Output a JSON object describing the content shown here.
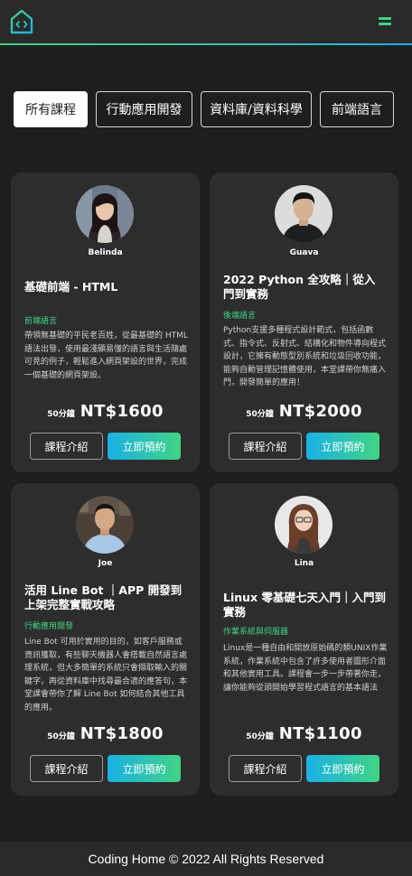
{
  "header": {
    "logo_icon": "code-house-logo",
    "menu_icon": "hamburger-menu-icon",
    "accent_colors": [
      "#41d483",
      "#1ab0e6"
    ]
  },
  "tabs": [
    {
      "label": "所有課程",
      "active": true
    },
    {
      "label": "行動應用開發",
      "active": false
    },
    {
      "label": "資料庫/資料科學",
      "active": false
    },
    {
      "label": "前端語言",
      "active": false
    }
  ],
  "courses": [
    {
      "teacher": "Belinda",
      "title": "基礎前端 - HTML",
      "category": "前端語言",
      "description": "帶領無基礎的平民老百姓，從最基礎的 HTML 語法出發，使用最淺顯易懂的語言與生活隨處可見的例子，輕鬆進入網頁架設的世界，完成一個基礎的網頁架設。",
      "duration": "50分鐘",
      "price": "NT$1600",
      "intro_label": "課程介紹",
      "book_label": "立即預約"
    },
    {
      "teacher": "Guava",
      "title": "2022 Python 全攻略｜從入門到實務",
      "category": "後端語言",
      "description": "Python支援多種程式設計範式，包括函數式、指令式、反射式、結構化和物件導向程式設計，它擁有動態型別系統和垃圾回收功能，能夠自動管理記憶體使用，本堂課帶你無痛入門，開發簡單的應用！",
      "duration": "50分鐘",
      "price": "NT$2000",
      "intro_label": "課程介紹",
      "book_label": "立即預約"
    },
    {
      "teacher": "Joe",
      "title": "活用 Line Bot ｜APP 開發到上架完整實戰攻略",
      "category": "行動應用開發",
      "description": "Line Bot 可用於實用的目的，如客戶服務或資訊獲取，有些聊天機器人會搭載自然語言處理系統，但大多簡單的系統只會擷取輸入的關鍵字，再從資料庫中找尋最合適的應答句，本堂課會帶你了解 Line Bot 如何結合其他工具的應用。",
      "duration": "50分鐘",
      "price": "NT$1800",
      "intro_label": "課程介紹",
      "book_label": "立即預約"
    },
    {
      "teacher": "Lina",
      "title": "Linux 零基礎七天入門｜入門到實務",
      "category": "作業系統與伺服器",
      "description": "Linux是一種自由和開放原始碼的類UNIX作業系統，作業系統中包含了許多使用者圖形介面和其他實用工具。課程會一步一步帶著你走，讓你能夠從頭開始學習程式語言的基本語法",
      "duration": "50分鐘",
      "price": "NT$1100",
      "intro_label": "課程介紹",
      "book_label": "立即預約"
    }
  ],
  "footer": {
    "text": "Coding Home © 2022 All Rights Reserved"
  }
}
